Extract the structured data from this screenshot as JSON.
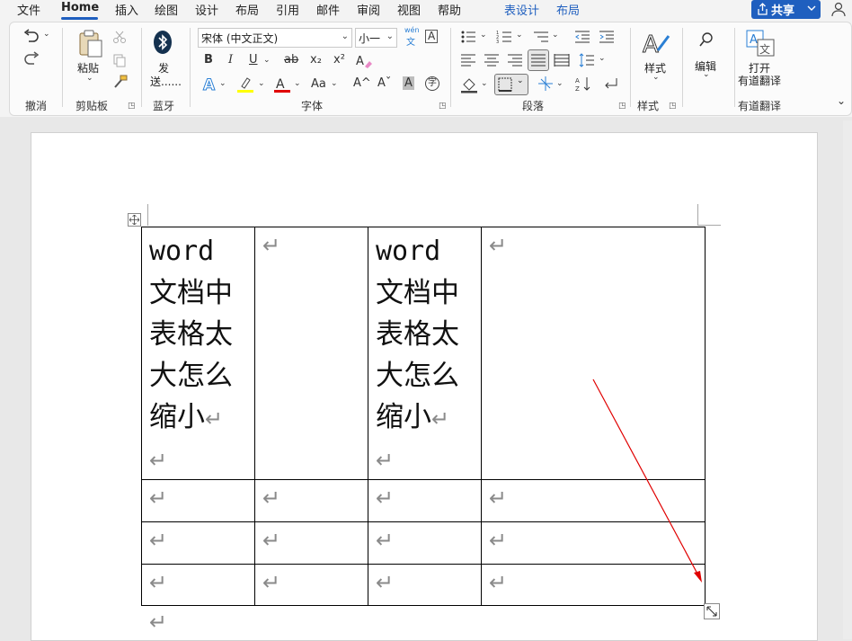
{
  "menubar": {
    "items": [
      "文件",
      "Home",
      "插入",
      "绘图",
      "设计",
      "布局",
      "引用",
      "邮件",
      "审阅",
      "视图",
      "帮助"
    ],
    "context_items": [
      "表设计",
      "布局"
    ],
    "share_label": "共享"
  },
  "ribbon": {
    "undo_group": {
      "label": "撤消"
    },
    "clipboard": {
      "paste_label": "粘贴",
      "label": "剪贴板"
    },
    "bluetooth": {
      "send_label_1": "发",
      "send_label_2": "送......",
      "label": "蓝牙"
    },
    "font": {
      "font_name": "宋体 (中文正文)",
      "font_size": "小一",
      "phonetic": "wén",
      "phonetic_char": "文",
      "label": "字体",
      "bold": "B",
      "italic": "I",
      "underline": "U",
      "strike": "ab",
      "subscript": "x₂",
      "superscript": "x²",
      "change_case": "Aa",
      "grow": "A^",
      "shrink": "Aˇ",
      "enclose": "字",
      "shade": "A"
    },
    "paragraph": {
      "label": "段落"
    },
    "styles": {
      "styles_label": "样式",
      "label": "样式"
    },
    "editing": {
      "label": "编辑"
    },
    "youdao": {
      "open_label_1": "打开",
      "open_label_2": "有道翻译",
      "label": "有道翻译"
    }
  },
  "document": {
    "cell_text_en": "word",
    "cell_text_cn": [
      "文档中",
      "表格太",
      "大怎么",
      "缩小"
    ],
    "return_mark": "↵"
  },
  "colors": {
    "accent": "#1f5fbf",
    "highlight": "#ffff00",
    "font_color": "#e00000",
    "annotation_arrow": "#e00000"
  }
}
